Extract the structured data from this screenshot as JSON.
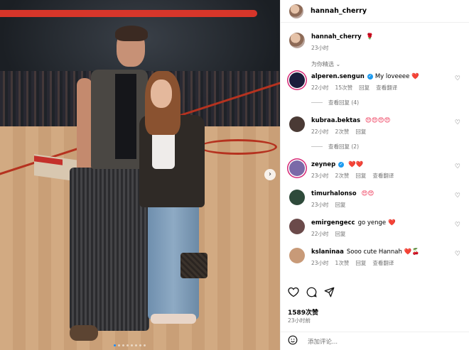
{
  "post": {
    "username": "hannah_cherry",
    "image_alt": "Two people posing on a basketball court",
    "carousel": {
      "total_dots": 8,
      "active_index": 0
    },
    "caption": {
      "user": "hannah_cherry",
      "emoji": "🌹",
      "time": "23小时"
    }
  },
  "comments_section": {
    "sort_label": "为你精选",
    "comments": [
      {
        "user": "alperen.sengun",
        "verified": true,
        "text": "My loveeee",
        "emoji": "❤️",
        "time": "22小时",
        "likes": "15次赞",
        "reply": "回复",
        "translate": "查看翻译",
        "view_replies": "查看回复 (4)",
        "avatar_color": "#1b1d3c"
      },
      {
        "user": "kubraa.bektas",
        "verified": false,
        "text": "",
        "emoji": "😍😍😍😍",
        "time": "22小时",
        "likes": "2次赞",
        "reply": "回复",
        "translate": "",
        "view_replies": "查看回复 (2)",
        "avatar_color": "#4a3a35"
      },
      {
        "user": "zeynep",
        "verified": true,
        "text": "",
        "emoji": "❤️❤️",
        "time": "23小时",
        "likes": "2次赞",
        "reply": "回复",
        "translate": "查看翻译",
        "view_replies": "",
        "avatar_color": "#7b6aa8"
      },
      {
        "user": "timurhalonso",
        "verified": false,
        "text": "",
        "emoji": "😍😍",
        "time": "23小时",
        "likes": "",
        "reply": "回复",
        "translate": "",
        "view_replies": "",
        "avatar_color": "#2e4a3a"
      },
      {
        "user": "emirgengecc",
        "verified": false,
        "text": "go yenge",
        "emoji": "❤️",
        "time": "22小时",
        "likes": "",
        "reply": "回复",
        "translate": "",
        "view_replies": "",
        "avatar_color": "#6b4a4a"
      },
      {
        "user": "kslaninaa",
        "verified": false,
        "text": "Sooo cute Hannah",
        "emoji": "❤️🍒",
        "time": "23小时",
        "likes": "1次赞",
        "reply": "回复",
        "translate": "查看翻译",
        "view_replies": "",
        "avatar_color": "#c89a78"
      }
    ]
  },
  "footer": {
    "likes": "1589次赞",
    "time": "23小时前",
    "comment_placeholder": "添加评论...",
    "icons": [
      "heart-icon",
      "comment-icon",
      "share-icon"
    ]
  }
}
